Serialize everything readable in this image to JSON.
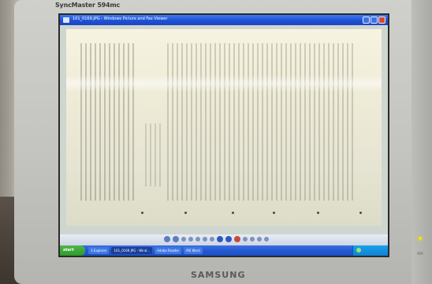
{
  "monitor": {
    "model": "SyncMaster 594mc",
    "brand": "SAMSUNG",
    "power_led_color": "#f5e400"
  },
  "window": {
    "title": "101_0169.JPG - Windows Picture and Fax Viewer"
  },
  "toolbar": {
    "icons": [
      "previous-icon",
      "next-icon",
      "best-fit-icon",
      "actual-size-icon",
      "slideshow-icon",
      "zoom-in-icon",
      "zoom-out-icon",
      "rotate-cw-icon",
      "rotate-ccw-icon",
      "delete-icon",
      "print-icon",
      "copy-icon",
      "edit-icon",
      "help-icon"
    ]
  },
  "taskbar": {
    "start_label": "start",
    "tasks": [
      "3 Explorer",
      "101_0169.JPG - Wind...",
      "Adobe Reader",
      "MS Word"
    ],
    "active_task_index": 1,
    "clock": ""
  }
}
